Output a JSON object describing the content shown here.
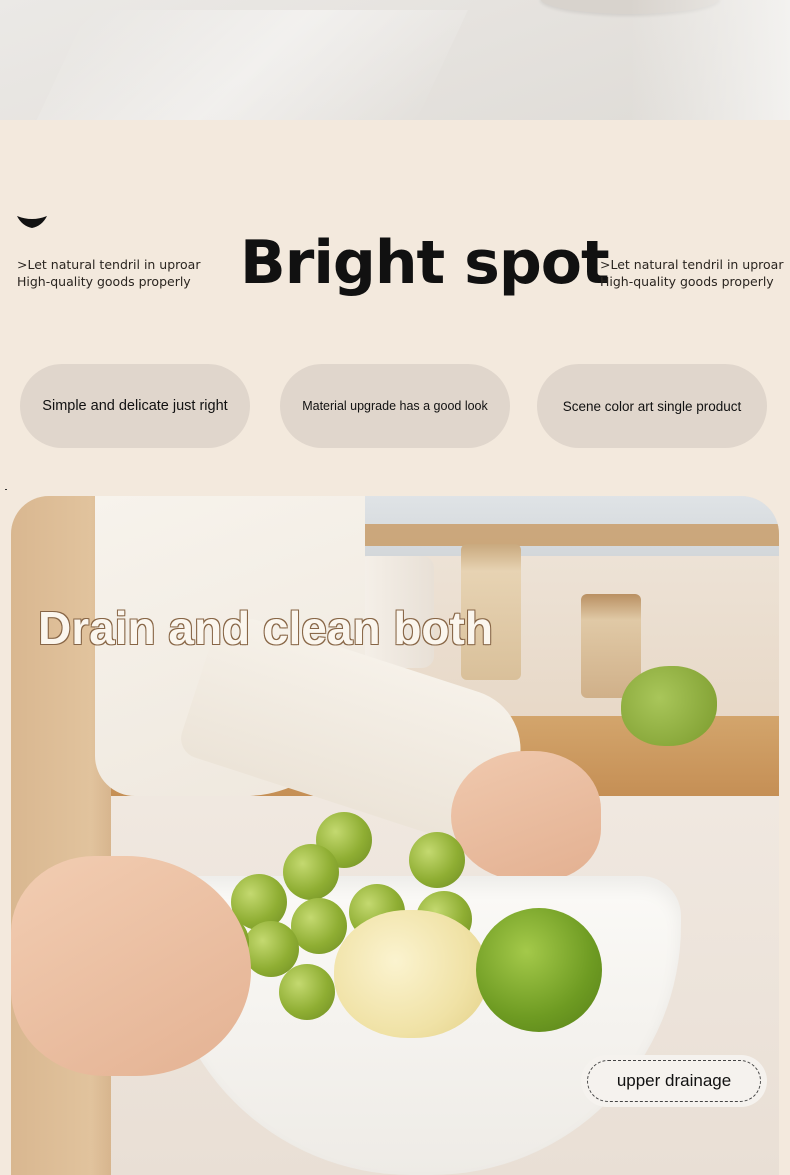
{
  "spotlight": {
    "side_left": {
      "line1": ">Let natural tendril in uproar",
      "line2": "High-quality goods properly"
    },
    "title": "Bright spot",
    "side_right": {
      "line1": ">Let natural tendril in uproar",
      "line2": "High-quality goods properly"
    },
    "icon": "chevron-down-icon"
  },
  "features": [
    {
      "label": "Simple and delicate just right"
    },
    {
      "label": "Material upgrade has a good look"
    },
    {
      "label": "Scene color art single product"
    }
  ],
  "feature_photo": {
    "title": "Drain and clean both",
    "badge": "upper drainage"
  },
  "colors": {
    "background": "#f3e9dd",
    "pill": "#e0d6cc",
    "title_text": "#111111"
  }
}
